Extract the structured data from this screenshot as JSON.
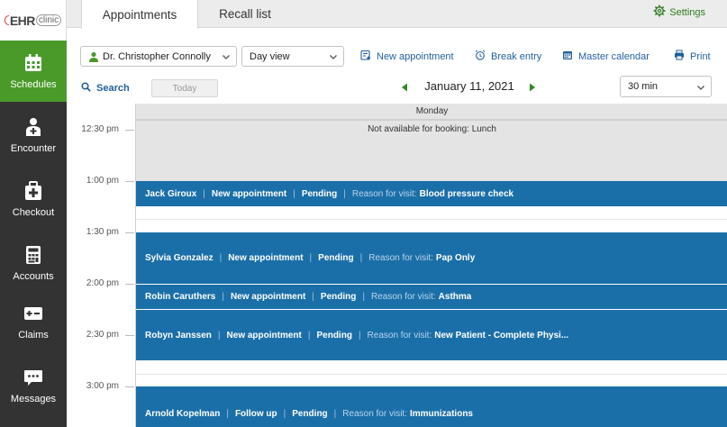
{
  "logo": {
    "main": "EHR",
    "sub": "clinic"
  },
  "sidebar": {
    "items": [
      {
        "label": "Schedules",
        "icon": "calendar-icon",
        "active": true
      },
      {
        "label": "Encounter",
        "icon": "doctor-icon",
        "active": false
      },
      {
        "label": "Checkout",
        "icon": "medical-bag-icon",
        "active": false
      },
      {
        "label": "Accounts",
        "icon": "calculator-icon",
        "active": false
      },
      {
        "label": "Claims",
        "icon": "claims-card-icon",
        "active": false
      },
      {
        "label": "Messages",
        "icon": "chat-bubble-icon",
        "active": false
      }
    ]
  },
  "tabs": [
    {
      "label": "Appointments",
      "active": true
    },
    {
      "label": "Recall list",
      "active": false
    }
  ],
  "settings_label": "Settings",
  "toolbar": {
    "provider": "Dr. Christopher Connolly",
    "view": "Day view",
    "new_appointment": "New appointment",
    "break_entry": "Break entry",
    "master_calendar": "Master calendar",
    "print": "Print",
    "search": "Search",
    "today": "Today",
    "date": "January 11, 2021",
    "interval": "30 min"
  },
  "calendar": {
    "day": "Monday",
    "times": [
      "12:30 pm",
      "1:00 pm",
      "1:30 pm",
      "2:00 pm",
      "2:30 pm",
      "3:00 pm"
    ],
    "unavailable": "Not available for booking: Lunch",
    "reason_label": "Reason for visit:",
    "appointments": [
      {
        "patient": "Jack Giroux",
        "type": "New appointment",
        "status": "Pending",
        "reason": "Blood pressure check"
      },
      {
        "patient": "Sylvia Gonzalez",
        "type": "New appointment",
        "status": "Pending",
        "reason": "Pap Only"
      },
      {
        "patient": "Robin Caruthers",
        "type": "New appointment",
        "status": "Pending",
        "reason": "Asthma"
      },
      {
        "patient": "Robyn Janssen",
        "type": "New appointment",
        "status": "Pending",
        "reason": "New Patient - Complete Physi..."
      },
      {
        "patient": "Arnold Kopelman",
        "type": "Follow up",
        "status": "Pending",
        "reason": "Immunizations"
      }
    ]
  },
  "colors": {
    "sidebar_bg": "#333333",
    "active_green": "#4a9a2a",
    "appointment_blue": "#1b6fa8",
    "link_blue": "#1f5f9e",
    "unavailable_gray": "#e4e4e4"
  }
}
